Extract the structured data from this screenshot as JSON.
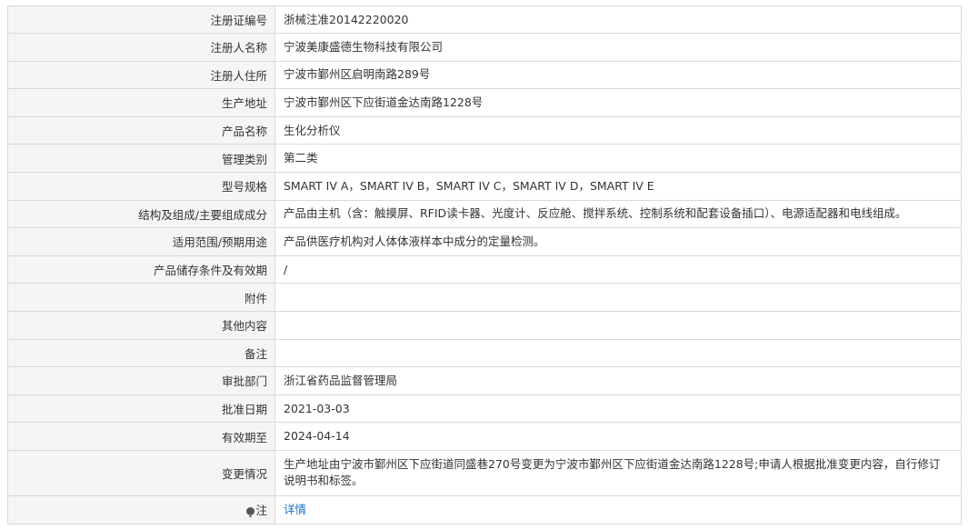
{
  "rows": [
    {
      "label": "注册证编号",
      "value": "浙械注准20142220020"
    },
    {
      "label": "注册人名称",
      "value": "宁波美康盛德生物科技有限公司"
    },
    {
      "label": "注册人住所",
      "value": "宁波市鄞州区启明南路289号"
    },
    {
      "label": "生产地址",
      "value": "宁波市鄞州区下应街道金达南路1228号"
    },
    {
      "label": "产品名称",
      "value": "生化分析仪"
    },
    {
      "label": "管理类别",
      "value": "第二类"
    },
    {
      "label": "型号规格",
      "value": "SMART IV A，SMART IV B，SMART IV C，SMART IV D，SMART IV E"
    },
    {
      "label": "结构及组成/主要组成成分",
      "value": "产品由主机（含：触摸屏、RFID读卡器、光度计、反应舱、搅拌系统、控制系统和配套设备插口）、电源适配器和电线组成。"
    },
    {
      "label": "适用范围/预期用途",
      "value": "产品供医疗机构对人体体液样本中成分的定量检测。"
    },
    {
      "label": "产品储存条件及有效期",
      "value": "/"
    },
    {
      "label": "附件",
      "value": ""
    },
    {
      "label": "其他内容",
      "value": ""
    },
    {
      "label": "备注",
      "value": ""
    },
    {
      "label": "审批部门",
      "value": "浙江省药品监督管理局"
    },
    {
      "label": "批准日期",
      "value": "2021-03-03"
    },
    {
      "label": "有效期至",
      "value": "2024-04-14"
    },
    {
      "label": "变更情况",
      "value": "生产地址由宁波市鄞州区下应街道同盛巷270号变更为宁波市鄞州区下应街道金达南路1228号;申请人根据批准变更内容，自行修订说明书和标签。"
    }
  ],
  "note": {
    "label": "注",
    "icon": "note-pin-icon",
    "link_text": "详情"
  }
}
